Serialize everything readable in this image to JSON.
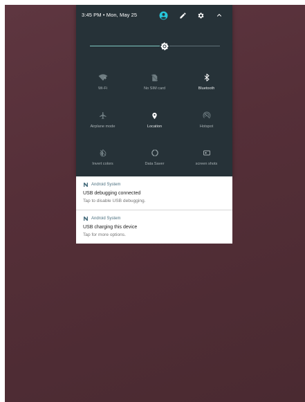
{
  "status_bar": {
    "time_date": "3:45 PM • Mon, May 25",
    "icons": [
      "account-icon",
      "edit-icon",
      "settings-icon",
      "collapse-icon"
    ],
    "accent_color": "#26c6da"
  },
  "brightness": {
    "level": 0.58,
    "icon": "brightness-icon"
  },
  "quick_settings": {
    "tiles": [
      {
        "label": "Wi-Fi",
        "icon": "wifi-icon",
        "state": "off"
      },
      {
        "label": "No SIM card",
        "icon": "no-sim-icon",
        "state": "off"
      },
      {
        "label": "Bluetooth",
        "icon": "bluetooth-icon",
        "state": "on"
      },
      {
        "label": "Airplane mode",
        "icon": "airplane-icon",
        "state": "off"
      },
      {
        "label": "Location",
        "icon": "location-icon",
        "state": "on"
      },
      {
        "label": "Hotspot",
        "icon": "hotspot-icon",
        "state": "off"
      },
      {
        "label": "Invert colors",
        "icon": "invert-colors-icon",
        "state": "off"
      },
      {
        "label": "Data Saver",
        "icon": "data-saver-icon",
        "state": "off"
      },
      {
        "label": "screen shots",
        "icon": "screenshot-icon",
        "state": "off"
      }
    ]
  },
  "notifications": [
    {
      "app": "Android System",
      "title": "USB debugging connected",
      "text": "Tap to disable USB debugging."
    },
    {
      "app": "Android System",
      "title": "USB charging this device",
      "text": "Tap for more options."
    }
  ],
  "colors": {
    "shade_bg": "#263238",
    "wallpaper": "#552f38",
    "notification_bg": "#ffffff",
    "app_name": "#4a6f7f"
  }
}
